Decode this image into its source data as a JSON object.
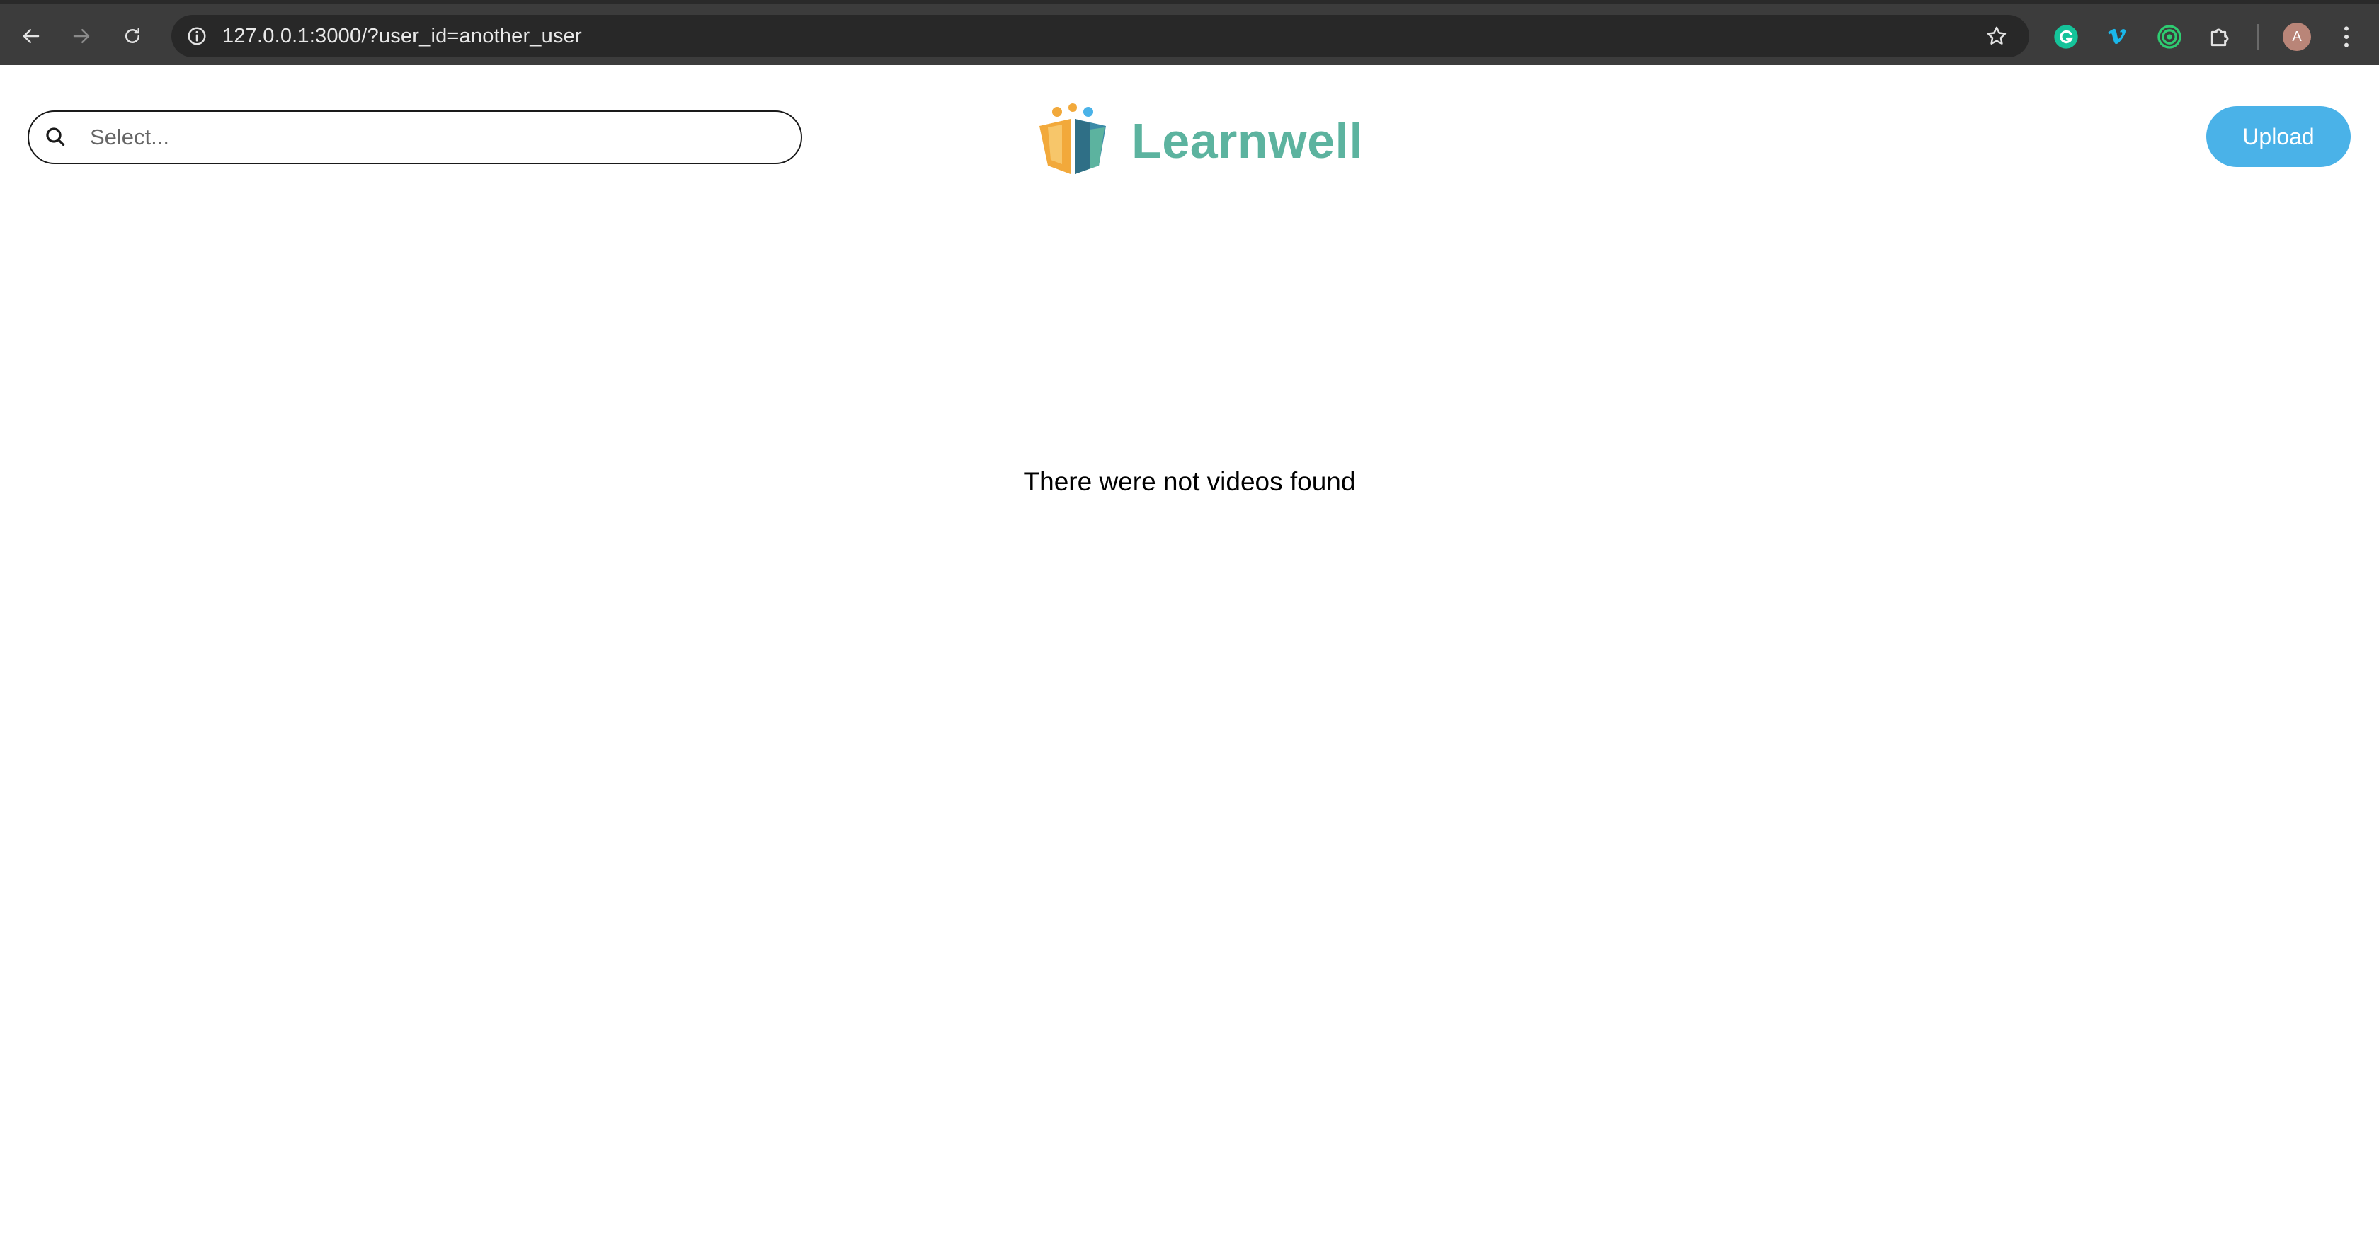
{
  "browser": {
    "url": "127.0.0.1:3000/?user_id=another_user",
    "profile_initial": "A",
    "icons": [
      "back-arrow-icon",
      "forward-arrow-icon",
      "reload-icon",
      "site-info-icon",
      "bookmark-star-icon",
      "grammarly-icon",
      "vimeo-icon",
      "circle-extension-icon",
      "extensions-puzzle-icon",
      "kebab-menu-icon"
    ]
  },
  "header": {
    "search": {
      "placeholder": "Select..."
    },
    "brand": {
      "name": "Learnwell"
    },
    "upload_label": "Upload"
  },
  "main": {
    "empty_message": "There were not videos found"
  },
  "colors": {
    "brand_green": "#5cb39f",
    "upload_blue": "#4ab2e8",
    "chrome_dark": "#3c3c3c"
  }
}
